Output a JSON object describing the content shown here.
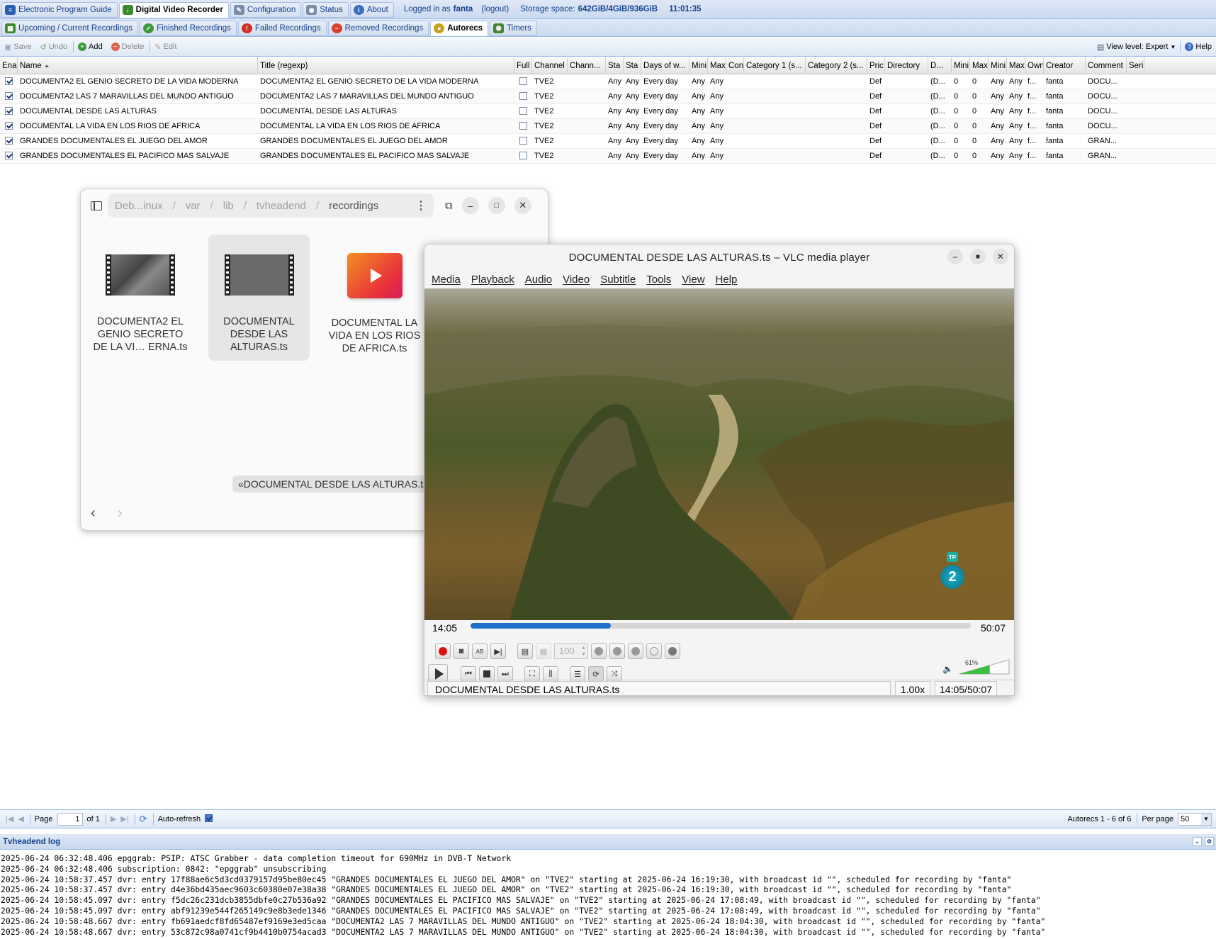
{
  "topbar": {
    "tabs": [
      {
        "label": "Electronic Program Guide",
        "icon": "epg-icon"
      },
      {
        "label": "Digital Video Recorder",
        "icon": "dvr-icon",
        "active": true
      },
      {
        "label": "Configuration",
        "icon": "wrench-icon"
      },
      {
        "label": "Status",
        "icon": "eye-icon"
      },
      {
        "label": "About",
        "icon": "info-icon"
      }
    ],
    "logged_in_label": "Logged in as",
    "user": "fanta",
    "logout": "(logout)",
    "storage_label": "Storage space:",
    "storage_value": "642GiB/4GiB/936GiB",
    "time": "11:01:35"
  },
  "subtabs": [
    {
      "label": "Upcoming / Current Recordings",
      "icon": "calendar-icon"
    },
    {
      "label": "Finished Recordings",
      "icon": "check-icon"
    },
    {
      "label": "Failed Recordings",
      "icon": "alert-icon"
    },
    {
      "label": "Removed Recordings",
      "icon": "minus-icon"
    },
    {
      "label": "Autorecs",
      "icon": "autorec-icon",
      "active": true
    },
    {
      "label": "Timers",
      "icon": "timer-icon"
    }
  ],
  "toolbar": {
    "save": "Save",
    "undo": "Undo",
    "add": "Add",
    "delete": "Delete",
    "edit": "Edit",
    "view_level": "View level: Expert",
    "help": "Help"
  },
  "grid": {
    "columns": [
      "Ena",
      "Name",
      "Title (regexp)",
      "Full",
      "Channel",
      "Chann...",
      "Sta",
      "Sta",
      "Days of w...",
      "Mini",
      "Max",
      "Con",
      "Category 1 (s...",
      "Category 2 (s...",
      "Pric",
      "Directory",
      "D...",
      "Mini",
      "Max",
      "Mini",
      "Max",
      "Own",
      "Creator",
      "Comment",
      "Seri"
    ],
    "sort_column": "Name",
    "rows": [
      {
        "enabled": true,
        "name": "DOCUMENTA2 EL GENIO SECRETO DE LA VIDA MODERNA",
        "title": "DOCUMENTA2 EL GENIO SECRETO DE LA VIDA MODERNA",
        "full": false,
        "channel": "TVE2",
        "tag": "",
        "start": "Any",
        "start2": "Any",
        "days": "Every day",
        "minlen": "Any",
        "maxlen": "Any",
        "content": "",
        "cat1": "",
        "cat2": "",
        "prio": "Def",
        "dir": "",
        "dvr": "(D...",
        "minyear": "0",
        "maxyear": "0",
        "minseason": "Any",
        "maxseason": "Any",
        "owner": "f...",
        "creator": "fanta",
        "comment": "DOCU..."
      },
      {
        "enabled": true,
        "name": "DOCUMENTA2 LAS 7 MARAVILLAS DEL MUNDO ANTIGUO",
        "title": "DOCUMENTA2 LAS 7 MARAVILLAS DEL MUNDO ANTIGUO",
        "full": false,
        "channel": "TVE2",
        "tag": "",
        "start": "Any",
        "start2": "Any",
        "days": "Every day",
        "minlen": "Any",
        "maxlen": "Any",
        "content": "",
        "cat1": "",
        "cat2": "",
        "prio": "Def",
        "dir": "",
        "dvr": "(D...",
        "minyear": "0",
        "maxyear": "0",
        "minseason": "Any",
        "maxseason": "Any",
        "owner": "f...",
        "creator": "fanta",
        "comment": "DOCU..."
      },
      {
        "enabled": true,
        "name": "DOCUMENTAL DESDE LAS ALTURAS",
        "title": "DOCUMENTAL DESDE LAS ALTURAS",
        "full": false,
        "channel": "TVE2",
        "tag": "",
        "start": "Any",
        "start2": "Any",
        "days": "Every day",
        "minlen": "Any",
        "maxlen": "Any",
        "content": "",
        "cat1": "",
        "cat2": "",
        "prio": "Def",
        "dir": "",
        "dvr": "(D...",
        "minyear": "0",
        "maxyear": "0",
        "minseason": "Any",
        "maxseason": "Any",
        "owner": "f...",
        "creator": "fanta",
        "comment": "DOCU..."
      },
      {
        "enabled": true,
        "name": "DOCUMENTAL LA VIDA EN LOS RIOS DE AFRICA",
        "title": "DOCUMENTAL LA VIDA EN LOS RIOS DE AFRICA",
        "full": false,
        "channel": "TVE2",
        "tag": "",
        "start": "Any",
        "start2": "Any",
        "days": "Every day",
        "minlen": "Any",
        "maxlen": "Any",
        "content": "",
        "cat1": "",
        "cat2": "",
        "prio": "Def",
        "dir": "",
        "dvr": "(D...",
        "minyear": "0",
        "maxyear": "0",
        "minseason": "Any",
        "maxseason": "Any",
        "owner": "f...",
        "creator": "fanta",
        "comment": "DOCU..."
      },
      {
        "enabled": true,
        "name": "GRANDES DOCUMENTALES EL JUEGO DEL AMOR",
        "title": "GRANDES DOCUMENTALES EL JUEGO DEL AMOR",
        "full": false,
        "channel": "TVE2",
        "tag": "",
        "start": "Any",
        "start2": "Any",
        "days": "Every day",
        "minlen": "Any",
        "maxlen": "Any",
        "content": "",
        "cat1": "",
        "cat2": "",
        "prio": "Def",
        "dir": "",
        "dvr": "(D...",
        "minyear": "0",
        "maxyear": "0",
        "minseason": "Any",
        "maxseason": "Any",
        "owner": "f...",
        "creator": "fanta",
        "comment": "GRAN..."
      },
      {
        "enabled": true,
        "name": "GRANDES DOCUMENTALES EL PACIFICO MAS SALVAJE",
        "title": "GRANDES DOCUMENTALES EL PACIFICO MAS SALVAJE",
        "full": false,
        "channel": "TVE2",
        "tag": "",
        "start": "Any",
        "start2": "Any",
        "days": "Every day",
        "minlen": "Any",
        "maxlen": "Any",
        "content": "",
        "cat1": "",
        "cat2": "",
        "prio": "Def",
        "dir": "",
        "dvr": "(D...",
        "minyear": "0",
        "maxyear": "0",
        "minseason": "Any",
        "maxseason": "Any",
        "owner": "f...",
        "creator": "fanta",
        "comment": "GRAN..."
      }
    ]
  },
  "files": {
    "path": [
      "Deb...inux",
      "var",
      "lib",
      "tvheadend",
      "recordings"
    ],
    "items": [
      {
        "label": "DOCUMENTA2 EL GENIO SECRETO DE LA VI… ERNA.ts",
        "type": "video"
      },
      {
        "label": "DOCUMENTAL DESDE LAS ALTURAS.ts",
        "type": "video",
        "selected": true
      },
      {
        "label": "DOCUMENTAL  LA VIDA EN LOS RIOS DE AFRICA.ts",
        "type": "media"
      }
    ],
    "tooltip": "«DOCUMENTAL  DESDE LAS ALTURAS.ts"
  },
  "vlc": {
    "title": "DOCUMENTAL  DESDE LAS ALTURAS.ts – VLC media player",
    "menu": [
      "Media",
      "Playback",
      "Audio",
      "Video",
      "Subtitle",
      "Tools",
      "View",
      "Help"
    ],
    "elapsed": "14:05",
    "total": "50:07",
    "progress": 0.281,
    "zoom_value": "100",
    "volume_label": "61%",
    "volume": 0.61,
    "status_file": "DOCUMENTAL  DESDE LAS ALTURAS.ts",
    "speed": "1.00x",
    "time_status": "14:05/50:07",
    "channel_logo": "2",
    "channel_logo_tag": "TP"
  },
  "pager": {
    "page_label": "Page",
    "page_value": "1",
    "of_label": "of 1",
    "auto_refresh": "Auto-refresh",
    "summary": "Autorecs 1 - 6 of 6",
    "per_page_label": "Per page",
    "per_page": "50"
  },
  "log": {
    "title": "Tvheadend log",
    "lines": [
      "2025-06-24 06:32:48.406 epggrab: PSIP: ATSC Grabber - data completion timeout for 690MHz in DVB-T Network",
      "2025-06-24 06:32:48.406 subscription: 0842: \"epggrab\" unsubscribing",
      "2025-06-24 10:58:37.457 dvr: entry 17f88ae6c5d3cd0379157d95be80ec45 \"GRANDES DOCUMENTALES EL JUEGO DEL AMOR\" on \"TVE2\" starting at 2025-06-24 16:19:30, with broadcast id \"\", scheduled for recording by \"fanta\"",
      "2025-06-24 10:58:37.457 dvr: entry d4e36bd435aec9603c60380e07e38a38 \"GRANDES DOCUMENTALES EL JUEGO DEL AMOR\" on \"TVE2\" starting at 2025-06-24 16:19:30, with broadcast id \"\", scheduled for recording by \"fanta\"",
      "2025-06-24 10:58:45.097 dvr: entry f5dc26c231dcb3855dbfe0c27b536a92 \"GRANDES DOCUMENTALES EL PACIFICO MAS SALVAJE\" on \"TVE2\" starting at 2025-06-24 17:08:49, with broadcast id \"\", scheduled for recording by \"fanta\"",
      "2025-06-24 10:58:45.097 dvr: entry abf91239e544f265149c9e8b3ede1346 \"GRANDES DOCUMENTALES EL PACIFICO MAS SALVAJE\" on \"TVE2\" starting at 2025-06-24 17:08:49, with broadcast id \"\", scheduled for recording by \"fanta\"",
      "2025-06-24 10:58:48.667 dvr: entry fb691aedcf8fd65487ef9169e3ed5caa \"DOCUMENTA2 LAS 7 MARAVILLAS DEL MUNDO ANTIGUO\" on \"TVE2\" starting at 2025-06-24 18:04:30, with broadcast id \"\", scheduled for recording by \"fanta\"",
      "2025-06-24 10:58:48.667 dvr: entry 53c872c98a0741cf9b4410b0754acad3 \"DOCUMENTA2 LAS 7 MARAVILLAS DEL MUNDO ANTIGUO\" on \"TVE2\" starting at 2025-06-24 18:04:30, with broadcast id \"\", scheduled for recording by \"fanta\""
    ]
  },
  "colors": {
    "accent": "#15428b",
    "vlc_progress": "#1e73c8",
    "record": "#e01010"
  }
}
